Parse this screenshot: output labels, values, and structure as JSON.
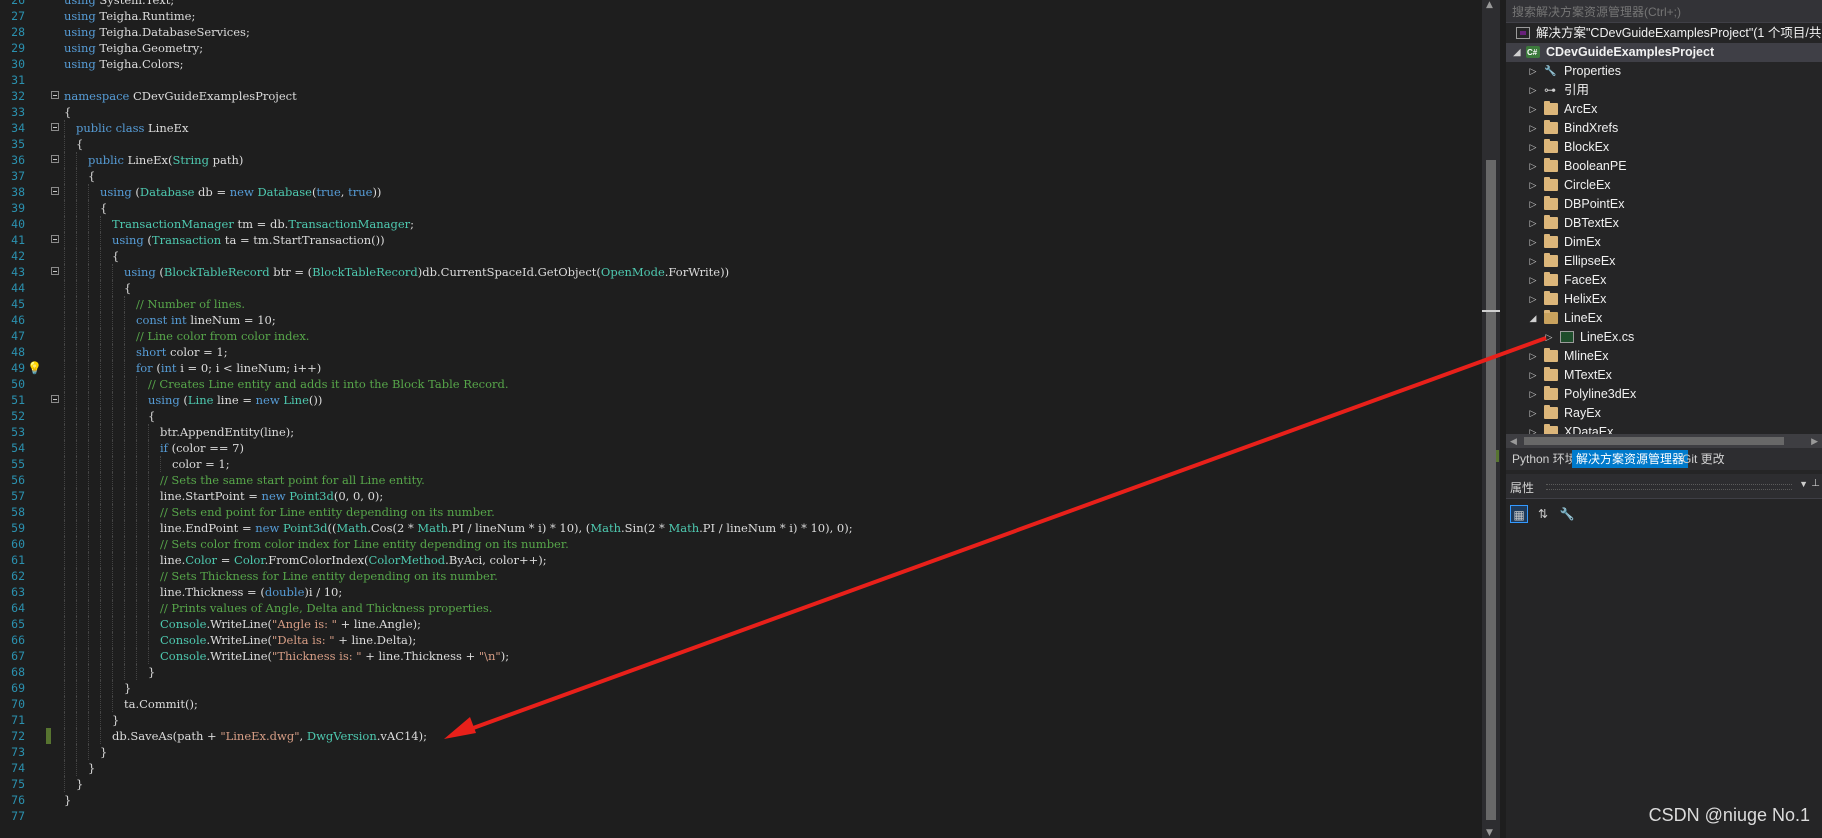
{
  "editor": {
    "lines": [
      {
        "n": "26",
        "t": "using System.Text;",
        "fold": false,
        "indent": 0
      },
      {
        "n": "27",
        "t": "using Teigha.Runtime;",
        "fold": false,
        "indent": 0
      },
      {
        "n": "28",
        "t": "using Teigha.DatabaseServices;",
        "fold": false,
        "indent": 0
      },
      {
        "n": "29",
        "t": "using Teigha.Geometry;",
        "fold": false,
        "indent": 0
      },
      {
        "n": "30",
        "t": "using Teigha.Colors;",
        "fold": false,
        "indent": 0
      },
      {
        "n": "31",
        "t": "",
        "fold": false,
        "indent": 0
      },
      {
        "n": "32",
        "t": "namespace CDevGuideExamplesProject",
        "fold": true,
        "indent": 0
      },
      {
        "n": "33",
        "t": "{",
        "fold": false,
        "indent": 0
      },
      {
        "n": "34",
        "t": "public class LineEx",
        "fold": true,
        "indent": 1
      },
      {
        "n": "35",
        "t": "{",
        "fold": false,
        "indent": 1
      },
      {
        "n": "36",
        "t": "public LineEx(String path)",
        "fold": true,
        "indent": 2
      },
      {
        "n": "37",
        "t": "{",
        "fold": false,
        "indent": 2
      },
      {
        "n": "38",
        "t": "using (Database db = new Database(true, true))",
        "fold": true,
        "indent": 3
      },
      {
        "n": "39",
        "t": "{",
        "fold": false,
        "indent": 3
      },
      {
        "n": "40",
        "t": "TransactionManager tm = db.TransactionManager;",
        "fold": false,
        "indent": 4
      },
      {
        "n": "41",
        "t": "using (Transaction ta = tm.StartTransaction())",
        "fold": true,
        "indent": 4
      },
      {
        "n": "42",
        "t": "{",
        "fold": false,
        "indent": 4
      },
      {
        "n": "43",
        "t": "using (BlockTableRecord btr = (BlockTableRecord)db.CurrentSpaceId.GetObject(OpenMode.ForWrite))",
        "fold": true,
        "indent": 5
      },
      {
        "n": "44",
        "t": "{",
        "fold": false,
        "indent": 5
      },
      {
        "n": "45",
        "t": "// Number of lines.",
        "fold": false,
        "indent": 6
      },
      {
        "n": "46",
        "t": "const int lineNum = 10;",
        "fold": false,
        "indent": 6
      },
      {
        "n": "47",
        "t": "// Line color from color index.",
        "fold": false,
        "indent": 6
      },
      {
        "n": "48",
        "t": "short color = 1;",
        "fold": false,
        "indent": 6
      },
      {
        "n": "49",
        "t": "for (int i = 0; i < lineNum; i++)",
        "fold": false,
        "indent": 6
      },
      {
        "n": "50",
        "t": "// Creates Line entity and adds it into the Block Table Record.",
        "fold": false,
        "indent": 7
      },
      {
        "n": "51",
        "t": "using (Line line = new Line())",
        "fold": true,
        "indent": 7
      },
      {
        "n": "52",
        "t": "{",
        "fold": false,
        "indent": 7
      },
      {
        "n": "53",
        "t": "btr.AppendEntity(line);",
        "fold": false,
        "indent": 8
      },
      {
        "n": "54",
        "t": "if (color == 7)",
        "fold": false,
        "indent": 8
      },
      {
        "n": "55",
        "t": "color = 1;",
        "fold": false,
        "indent": 9
      },
      {
        "n": "56",
        "t": "// Sets the same start point for all Line entity.",
        "fold": false,
        "indent": 8
      },
      {
        "n": "57",
        "t": "line.StartPoint = new Point3d(0, 0, 0);",
        "fold": false,
        "indent": 8
      },
      {
        "n": "58",
        "t": "// Sets end point for Line entity depending on its number.",
        "fold": false,
        "indent": 8
      },
      {
        "n": "59",
        "t": "line.EndPoint = new Point3d((Math.Cos(2 * Math.PI / lineNum * i) * 10), (Math.Sin(2 * Math.PI / lineNum * i) * 10), 0);",
        "fold": false,
        "indent": 8
      },
      {
        "n": "60",
        "t": "// Sets color from color index for Line entity depending on its number.",
        "fold": false,
        "indent": 8
      },
      {
        "n": "61",
        "t": "line.Color = Color.FromColorIndex(ColorMethod.ByAci, color++);",
        "fold": false,
        "indent": 8
      },
      {
        "n": "62",
        "t": "// Sets Thickness for Line entity depending on its number.",
        "fold": false,
        "indent": 8
      },
      {
        "n": "63",
        "t": "line.Thickness = (double)i / 10;",
        "fold": false,
        "indent": 8
      },
      {
        "n": "64",
        "t": "// Prints values of Angle, Delta and Thickness properties.",
        "fold": false,
        "indent": 8
      },
      {
        "n": "65",
        "t": "Console.WriteLine(\"Angle is: \" + line.Angle);",
        "fold": false,
        "indent": 8
      },
      {
        "n": "66",
        "t": "Console.WriteLine(\"Delta is: \" + line.Delta);",
        "fold": false,
        "indent": 8
      },
      {
        "n": "67",
        "t": "Console.WriteLine(\"Thickness is: \" + line.Thickness + \"\\n\");",
        "fold": false,
        "indent": 8
      },
      {
        "n": "68",
        "t": "}",
        "fold": false,
        "indent": 7
      },
      {
        "n": "69",
        "t": "}",
        "fold": false,
        "indent": 5
      },
      {
        "n": "70",
        "t": "ta.Commit();",
        "fold": false,
        "indent": 5
      },
      {
        "n": "71",
        "t": "}",
        "fold": false,
        "indent": 4
      },
      {
        "n": "72",
        "t": "db.SaveAs(path + \"LineEx.dwg\", DwgVersion.vAC14);",
        "fold": false,
        "indent": 4
      },
      {
        "n": "73",
        "t": "}",
        "fold": false,
        "indent": 3
      },
      {
        "n": "74",
        "t": "}",
        "fold": false,
        "indent": 2
      },
      {
        "n": "75",
        "t": "}",
        "fold": false,
        "indent": 1
      },
      {
        "n": "76",
        "t": "}",
        "fold": false,
        "indent": 0
      },
      {
        "n": "77",
        "t": "",
        "fold": false,
        "indent": 0
      }
    ],
    "current_line": "49",
    "changed_line": "72"
  },
  "solution_explorer": {
    "search_placeholder": "搜索解决方案资源管理器(Ctrl+;)",
    "solution_label": "解决方案\"CDevGuideExamplesProject\"(1 个项目/共",
    "project_label": "CDevGuideExamplesProject",
    "items": [
      {
        "label": "Properties",
        "icon": "wrench-icon",
        "level": 2,
        "expand": "collapsed"
      },
      {
        "label": "引用",
        "icon": "references-icon",
        "level": 2,
        "expand": "collapsed"
      },
      {
        "label": "ArcEx",
        "icon": "folder-icon",
        "level": 2,
        "expand": "collapsed"
      },
      {
        "label": "BindXrefs",
        "icon": "folder-icon",
        "level": 2,
        "expand": "collapsed"
      },
      {
        "label": "BlockEx",
        "icon": "folder-icon",
        "level": 2,
        "expand": "collapsed"
      },
      {
        "label": "BooleanPE",
        "icon": "folder-icon",
        "level": 2,
        "expand": "collapsed"
      },
      {
        "label": "CircleEx",
        "icon": "folder-icon",
        "level": 2,
        "expand": "collapsed"
      },
      {
        "label": "DBPointEx",
        "icon": "folder-icon",
        "level": 2,
        "expand": "collapsed"
      },
      {
        "label": "DBTextEx",
        "icon": "folder-icon",
        "level": 2,
        "expand": "collapsed"
      },
      {
        "label": "DimEx",
        "icon": "folder-icon",
        "level": 2,
        "expand": "collapsed"
      },
      {
        "label": "EllipseEx",
        "icon": "folder-icon",
        "level": 2,
        "expand": "collapsed"
      },
      {
        "label": "FaceEx",
        "icon": "folder-icon",
        "level": 2,
        "expand": "collapsed"
      },
      {
        "label": "HelixEx",
        "icon": "folder-icon",
        "level": 2,
        "expand": "collapsed"
      },
      {
        "label": "LineEx",
        "icon": "folder-open-icon",
        "level": 2,
        "expand": "expanded"
      },
      {
        "label": "LineEx.cs",
        "icon": "csharp-file-icon",
        "level": 3,
        "expand": "collapsed"
      },
      {
        "label": "MlineEx",
        "icon": "folder-icon",
        "level": 2,
        "expand": "collapsed"
      },
      {
        "label": "MTextEx",
        "icon": "folder-icon",
        "level": 2,
        "expand": "collapsed"
      },
      {
        "label": "Polyline3dEx",
        "icon": "folder-icon",
        "level": 2,
        "expand": "collapsed"
      },
      {
        "label": "RayEx",
        "icon": "folder-icon",
        "level": 2,
        "expand": "collapsed"
      },
      {
        "label": "XDataEx",
        "icon": "folder-icon",
        "level": 2,
        "expand": "collapsed"
      }
    ]
  },
  "panel_tabs": [
    {
      "label": "Python 环境",
      "active": false
    },
    {
      "label": "解决方案资源管理器",
      "active": true
    },
    {
      "label": "Git 更改",
      "active": false
    }
  ],
  "properties": {
    "title": "属性",
    "toolbar": [
      {
        "name": "categorized-icon",
        "glyph": "▦",
        "active": true
      },
      {
        "name": "alphabetical-icon",
        "glyph": "⇅",
        "active": false
      },
      {
        "name": "property-pages-icon",
        "glyph": "🔧",
        "active": false
      }
    ]
  },
  "annotation": {
    "color": "#e8201a"
  },
  "watermark": "CSDN @niuge No.1"
}
